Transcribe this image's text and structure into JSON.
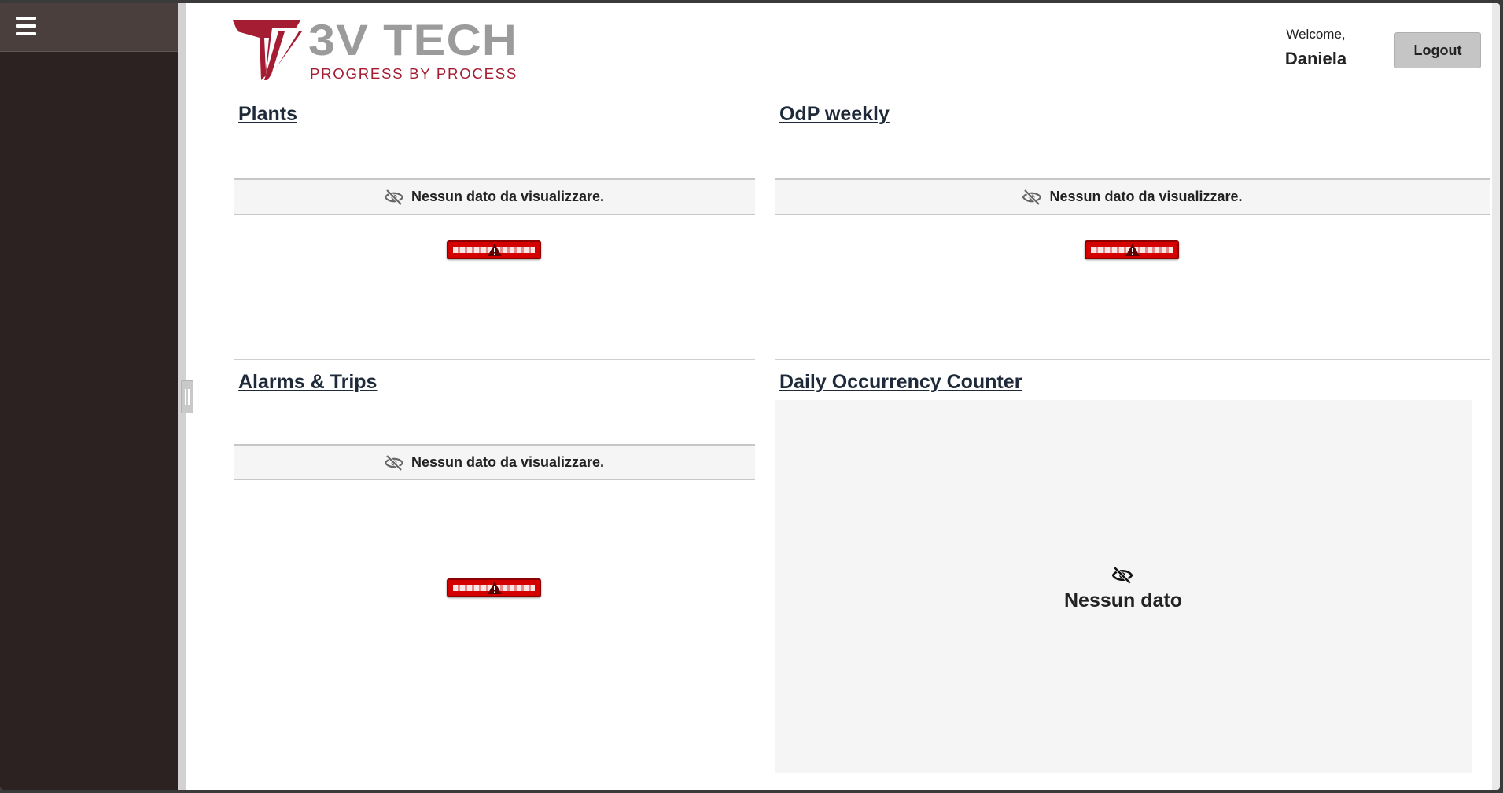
{
  "header": {
    "logo_primary": "3V TECH",
    "logo_tagline": "PROGRESS BY PROCESS",
    "welcome_label": "Welcome,",
    "user_name": "Daniela",
    "logout_label": "Logout"
  },
  "widgets": {
    "plants": {
      "title": "Plants",
      "empty_message": "Nessun dato da visualizzare."
    },
    "odp_weekly": {
      "title": "OdP weekly",
      "empty_message": "Nessun dato da visualizzare."
    },
    "alarms_trips": {
      "title": "Alarms & Trips",
      "empty_message": "Nessun dato da visualizzare."
    },
    "daily_counter": {
      "title": "Daily Occurrency Counter",
      "empty_message": "Nessun dato"
    }
  },
  "icons": {
    "menu": "hamburger-icon",
    "no_data": "eye-slash-icon",
    "error": "warning-icon"
  },
  "colors": {
    "sidebar": "#2b2221",
    "brand_red": "#a51d33",
    "brand_gray": "#9b9b9b",
    "error_red": "#d40000"
  }
}
